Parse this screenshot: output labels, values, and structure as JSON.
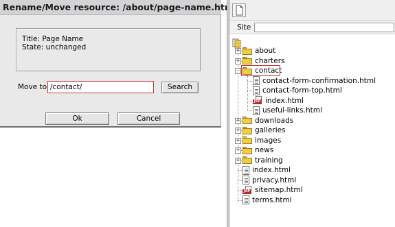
{
  "dialog": {
    "title": "Rename/Move resource: /about/page-name.html",
    "info": {
      "title_line": "Title: Page Name",
      "state_line": "State: unchanged"
    },
    "move_to_label": "Move to",
    "move_to_value": "/contact/",
    "search_label": "Search",
    "ok_label": "Ok",
    "cancel_label": "Cancel"
  },
  "panel": {
    "site_label": "Site",
    "site_value": ""
  },
  "tree": {
    "items": [
      {
        "label": "about",
        "kind": "folder",
        "expander": "+"
      },
      {
        "label": "charters",
        "kind": "folder",
        "expander": "+"
      },
      {
        "label": "contact",
        "kind": "folder-open",
        "expander": "-",
        "selected": true
      },
      {
        "label": "contact-form-confirmation.html",
        "kind": "html"
      },
      {
        "label": "contact-form-top.html",
        "kind": "html"
      },
      {
        "label": "index.html",
        "kind": "jsp"
      },
      {
        "label": "useful-links.html",
        "kind": "html"
      },
      {
        "label": "downloads",
        "kind": "folder",
        "expander": "+"
      },
      {
        "label": "galleries",
        "kind": "folder",
        "expander": "+"
      },
      {
        "label": "images",
        "kind": "folder",
        "expander": "+"
      },
      {
        "label": "news",
        "kind": "folder",
        "expander": "+"
      },
      {
        "label": "training",
        "kind": "folder",
        "expander": "+"
      },
      {
        "label": "index.html",
        "kind": "html"
      },
      {
        "label": "privacy.html",
        "kind": "html"
      },
      {
        "label": "sitemap.html",
        "kind": "jsp"
      },
      {
        "label": "terms.html",
        "kind": "html"
      }
    ]
  },
  "colors": {
    "selection_border": "#cc3a3a",
    "folder": "#f3cc45",
    "jsp_badge": "#b52a2a"
  }
}
